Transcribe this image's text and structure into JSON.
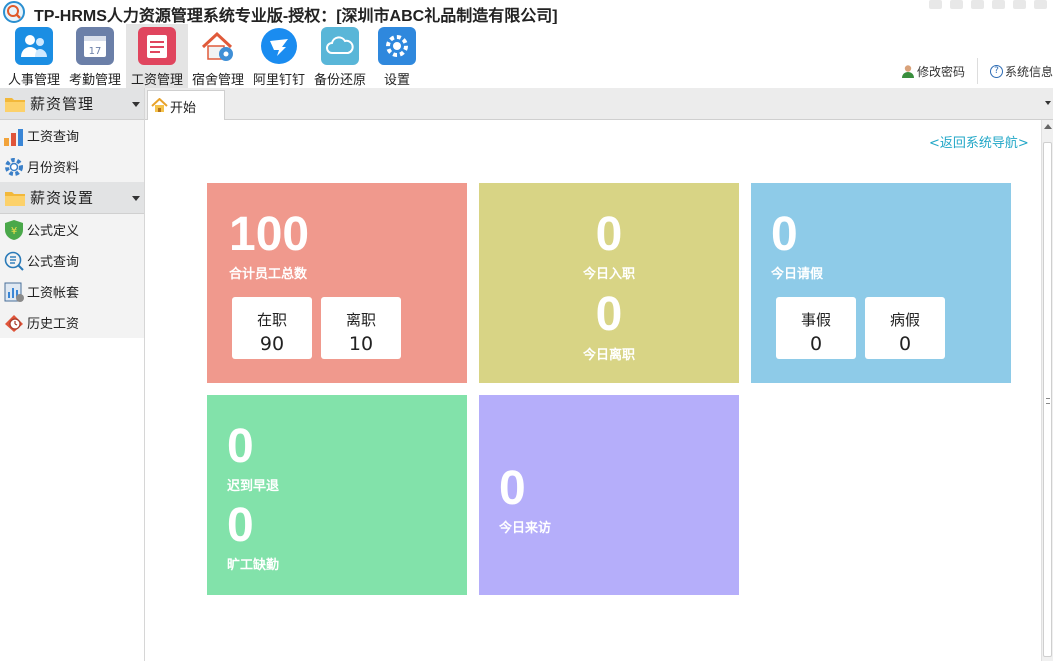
{
  "window": {
    "title": "TP-HRMS人力资源管理系统专业版-授权：[深圳市ABC礼品制造有限公司]",
    "logo_icon": "magnifier-logo-icon"
  },
  "toolbar": {
    "items": [
      {
        "label": "人事管理",
        "icon": "people-icon",
        "color": "#1b8ee3"
      },
      {
        "label": "考勤管理",
        "icon": "calendar-icon",
        "color": "#6b7fa8"
      },
      {
        "label": "工资管理",
        "icon": "payroll-icon",
        "color": "#e0455e"
      },
      {
        "label": "宿舍管理",
        "icon": "dorm-house-icon",
        "color": "#e05a3a"
      },
      {
        "label": "阿里钉钉",
        "icon": "dingtalk-icon",
        "color": "#1a8cf0"
      },
      {
        "label": "备份还原",
        "icon": "cloud-icon",
        "color": "#59b6d8"
      },
      {
        "label": "设置",
        "icon": "settings-icon",
        "color": "#2f88dd"
      }
    ],
    "active_index": 2
  },
  "user_links": {
    "change_password": "修改密码",
    "system_info": "系统信息"
  },
  "sidebar": {
    "groups": [
      {
        "title": "薪资管理",
        "items": [
          {
            "label": "工资查询",
            "icon": "bar-chart-icon"
          },
          {
            "label": "月份资料",
            "icon": "gear-icon"
          }
        ]
      },
      {
        "title": "薪资设置",
        "items": [
          {
            "label": "公式定义",
            "icon": "shield-yen-icon"
          },
          {
            "label": "公式查询",
            "icon": "search-list-icon"
          },
          {
            "label": "工资帐套",
            "icon": "report-icon"
          },
          {
            "label": "历史工资",
            "icon": "history-icon"
          }
        ]
      }
    ]
  },
  "tabs": [
    {
      "label": "开始",
      "icon": "home-icon"
    }
  ],
  "content": {
    "back_link": "<返回系统导航>",
    "tiles": {
      "total": {
        "value": "100",
        "label": "合计员工总数",
        "color": "#f0998d",
        "minis": [
          {
            "label": "在职",
            "value": "90"
          },
          {
            "label": "离职",
            "value": "10"
          }
        ]
      },
      "join_leave": {
        "color": "#d8d485",
        "join_value": "0",
        "join_label": "今日入职",
        "leave_value": "0",
        "leave_label": "今日离职"
      },
      "leave_req": {
        "value": "0",
        "label": "今日请假",
        "color": "#8ecbe8",
        "minis": [
          {
            "label": "事假",
            "value": "0"
          },
          {
            "label": "病假",
            "value": "0"
          }
        ]
      },
      "late": {
        "color": "#82e2aa",
        "late_value": "0",
        "late_label": "迟到早退",
        "absent_value": "0",
        "absent_label": "旷工缺勤"
      },
      "visitors": {
        "value": "0",
        "label": "今日来访",
        "color": "#b5aefa"
      }
    }
  }
}
